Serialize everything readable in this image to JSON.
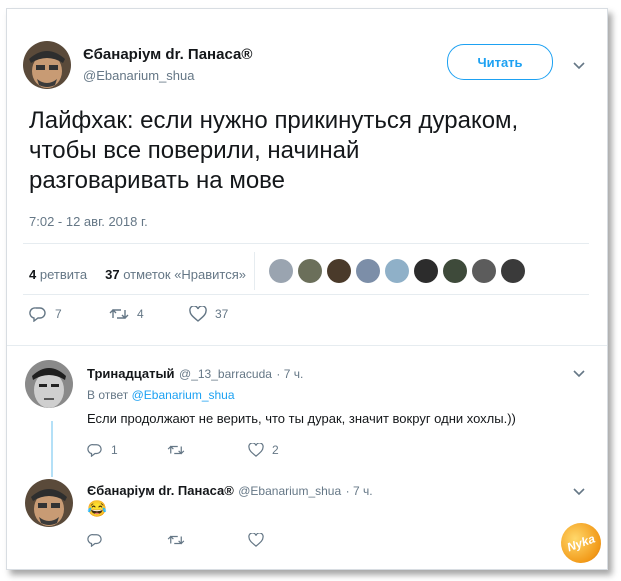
{
  "tweet": {
    "author_name": "Єбанаріум dr. Панаса®",
    "author_handle": "@Ebanarium_shua",
    "follow_label": "Читать",
    "text_line1": "Лайфхак: если нужно прикинуться дураком,",
    "text_line2": "чтобы все поверили, начинай",
    "text_line3": "разговаривать на мове",
    "timestamp": "7:02 - 12 авг. 2018 г.",
    "retweets_count": "4",
    "retweets_label": "ретвита",
    "likes_count": "37",
    "likes_label": "отметок «Нравится»",
    "liker_avatars": [
      "#9aa4b0",
      "#6b6f5a",
      "#4a3a2a",
      "#7c8ea8",
      "#8fb0c8",
      "#2c2c2c",
      "#3e4a3a",
      "#5c5c5c",
      "#3a3a3a"
    ],
    "actions": {
      "reply_count": "7",
      "retweet_count": "4",
      "like_count": "37"
    }
  },
  "reply1": {
    "author_name": "Тринадцатый",
    "author_handle": "@_13_barracuda",
    "time": "· 7 ч.",
    "in_reply_prefix": "В ответ",
    "in_reply_to": "@Ebanarium_shua",
    "text": "Если продолжают не верить, что ты дурак, значит вокруг одни хохлы.))",
    "actions": {
      "reply_count": "1",
      "retweet_count": "",
      "like_count": "2"
    }
  },
  "reply2": {
    "author_name": "Єбанаріум dr. Панаса®",
    "author_handle": "@Ebanarium_shua",
    "time": "· 7 ч.",
    "emoji": "😂"
  },
  "watermark": "Nyka",
  "colors": {
    "accent": "#1da1f2",
    "muted": "#657786",
    "divider": "#e6ecf0"
  }
}
